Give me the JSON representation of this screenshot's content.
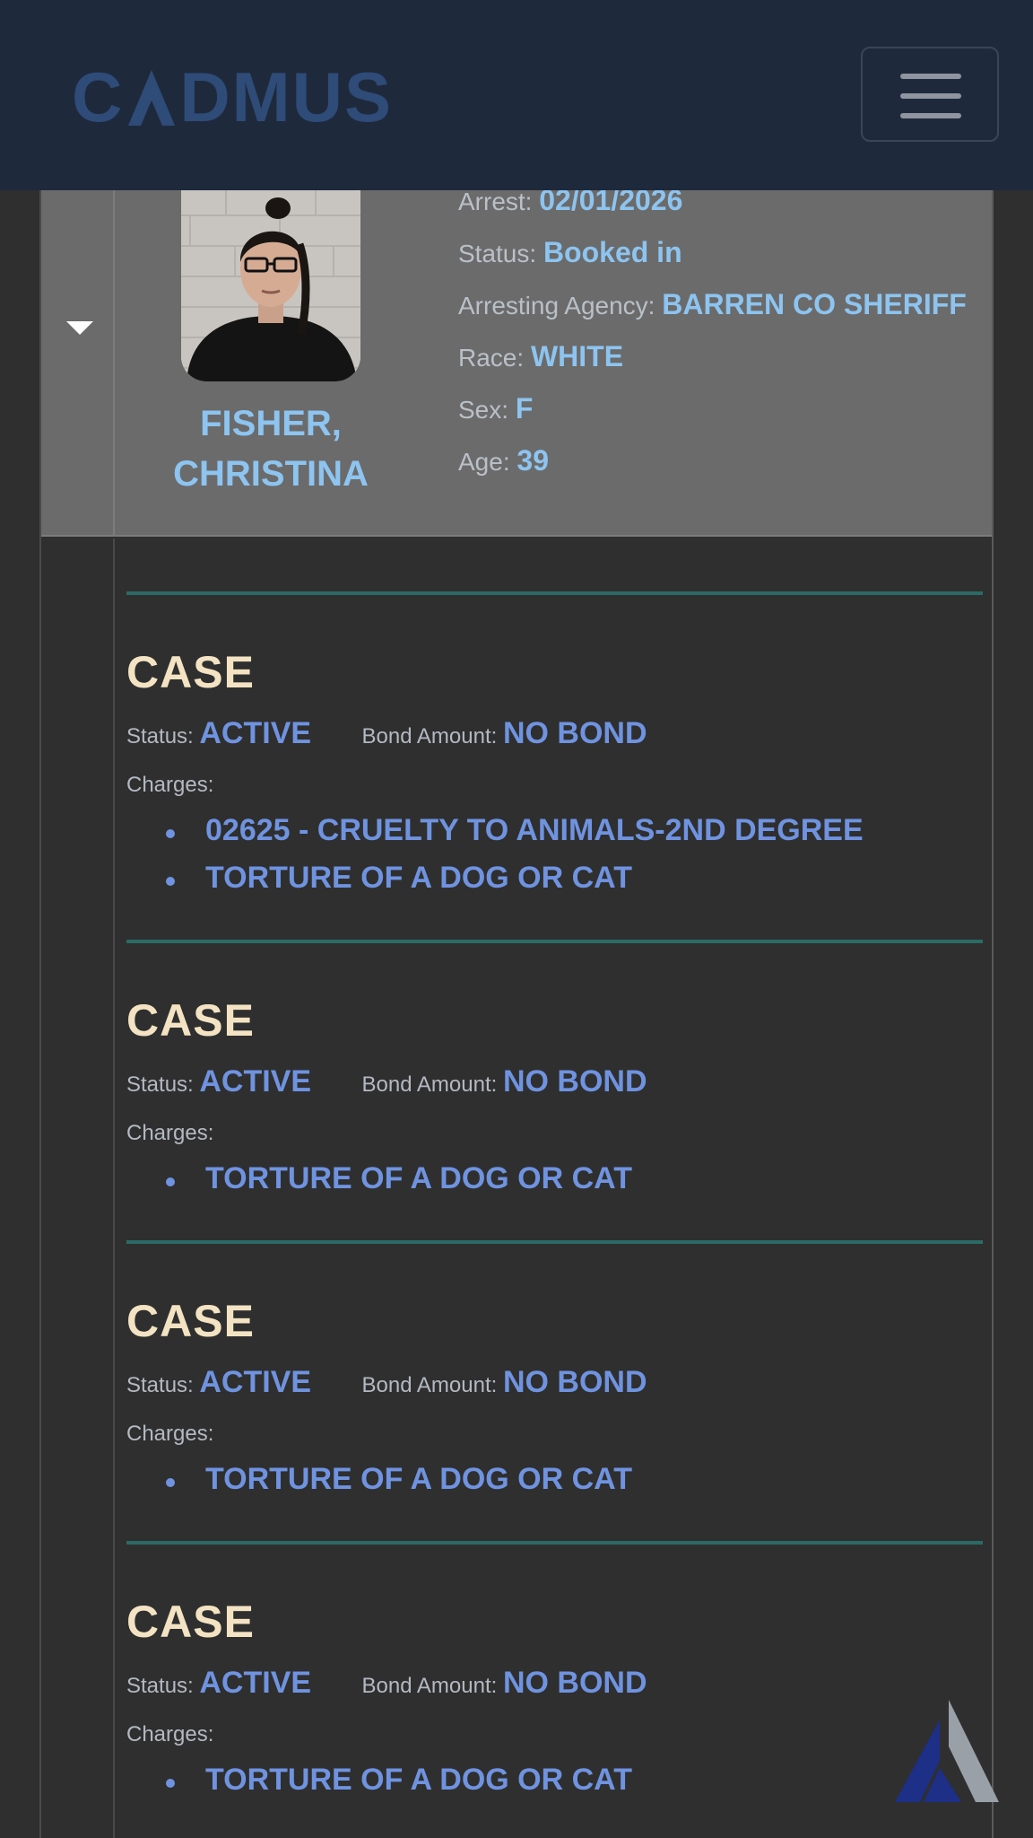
{
  "app": {
    "brand_name": "CADMUS",
    "colors": {
      "navbar": "#1e2a3c",
      "brand": "#2f4b78",
      "name_blue": "#8dc4f0",
      "value_blue": "#6f93e0",
      "case_title": "#f3e3c3",
      "divider": "#2b6a66"
    },
    "menu_icon": "hamburger-menu-icon"
  },
  "inmate": {
    "name_line1": "FISHER,",
    "name_line2": "CHRISTINA",
    "arrest_label": "Arrest: ",
    "arrest_value": "02/01/2026",
    "status_label": "Status: ",
    "status_value": "Booked in",
    "agency_label": "Arresting Agency: ",
    "agency_value": "BARREN CO SHERIFF",
    "race_label": "Race: ",
    "race_value": "WHITE",
    "sex_label": "Sex: ",
    "sex_value": "F",
    "age_label": "Age: ",
    "age_value": "39"
  },
  "cases": [
    {
      "title": "CASE",
      "status_label": "Status: ",
      "status_value": "ACTIVE",
      "bond_label": "Bond Amount: ",
      "bond_value": "NO BOND",
      "charges_label": "Charges:",
      "charges": [
        "02625 - CRUELTY TO ANIMALS-2ND DEGREE",
        "TORTURE OF A DOG OR CAT"
      ]
    },
    {
      "title": "CASE",
      "status_label": "Status: ",
      "status_value": "ACTIVE",
      "bond_label": "Bond Amount: ",
      "bond_value": "NO BOND",
      "charges_label": "Charges:",
      "charges": [
        "TORTURE OF A DOG OR CAT"
      ]
    },
    {
      "title": "CASE",
      "status_label": "Status: ",
      "status_value": "ACTIVE",
      "bond_label": "Bond Amount: ",
      "bond_value": "NO BOND",
      "charges_label": "Charges:",
      "charges": [
        "TORTURE OF A DOG OR CAT"
      ]
    },
    {
      "title": "CASE",
      "status_label": "Status: ",
      "status_value": "ACTIVE",
      "bond_label": "Bond Amount: ",
      "bond_value": "NO BOND",
      "charges_label": "Charges:",
      "charges": [
        "TORTURE OF A DOG OR CAT"
      ]
    }
  ]
}
